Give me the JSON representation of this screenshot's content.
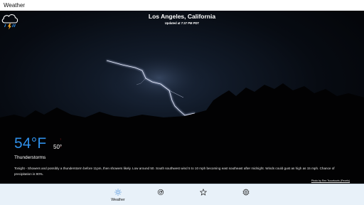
{
  "window": {
    "title": "Weather"
  },
  "location": {
    "city": "Los Angeles, California",
    "updated": "Updated at 7:37 PM PDT"
  },
  "current": {
    "temperature": "54°F",
    "low": "50°",
    "hi_indicator": "↑",
    "lo_indicator": "↓",
    "condition": "Thunderstorms",
    "condition_icon": "thunderstorm-icon"
  },
  "forecast_text": "Tonight - Showers and possibly a thunderstorm before 11pm, then showers likely.  Low around 50. South southwest wind 5 to 10 mph becoming east southeast after midnight. Winds could gust as high as 15 mph.  Chance of precipitation is 90%.",
  "photo_credit": "Photo by Rex Tsourtouris (Pexels)",
  "nav": {
    "items": [
      {
        "label": "Weather",
        "icon": "sun-icon",
        "active": true
      },
      {
        "label": "",
        "icon": "radar-icon",
        "active": false
      },
      {
        "label": "",
        "icon": "star-icon",
        "active": false
      },
      {
        "label": "",
        "icon": "gear-icon",
        "active": false
      }
    ]
  },
  "colors": {
    "accent": "#2f8fe8",
    "indicator_red": "#e03030",
    "navbar_bg": "#e8f1f9"
  }
}
